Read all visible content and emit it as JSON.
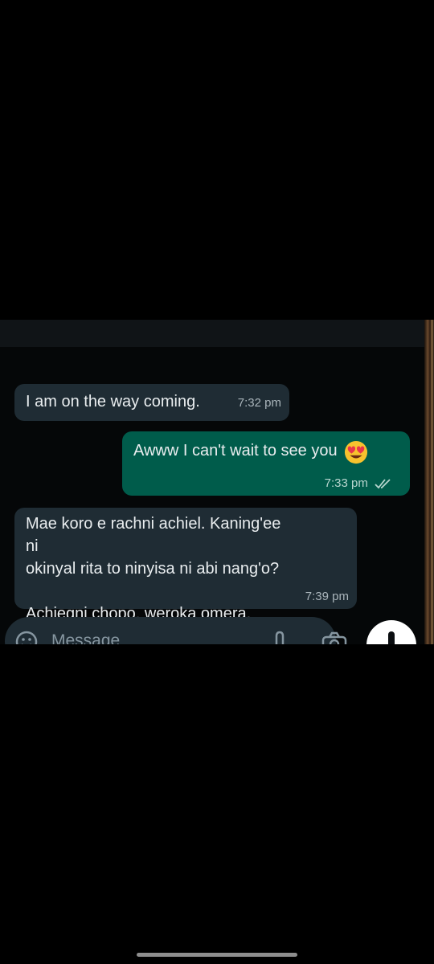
{
  "messages": [
    {
      "direction": "incoming",
      "text": "I am on the way coming.",
      "time": "7:32 pm"
    },
    {
      "direction": "outgoing",
      "text": "Awww I can't wait to see you",
      "emoji": "heart-eyes-emoji",
      "time": "7:33 pm",
      "status": "read"
    },
    {
      "direction": "incoming",
      "text": "Mae koro e rachni achiel. Kaning'ee ni\nokinyal rita to ninyisa ni abi nang'o?\n\nAchiegni chopo, weroka omera.",
      "time": "7:39 pm"
    }
  ],
  "composer": {
    "placeholder": "Message",
    "icons": [
      "emoji-icon",
      "attach-icon",
      "camera-icon"
    ],
    "send_icon": "mic-icon"
  },
  "colors": {
    "incoming_bubble": "#1f2c34",
    "outgoing_bubble": "#005c4b",
    "background": "#000000"
  }
}
